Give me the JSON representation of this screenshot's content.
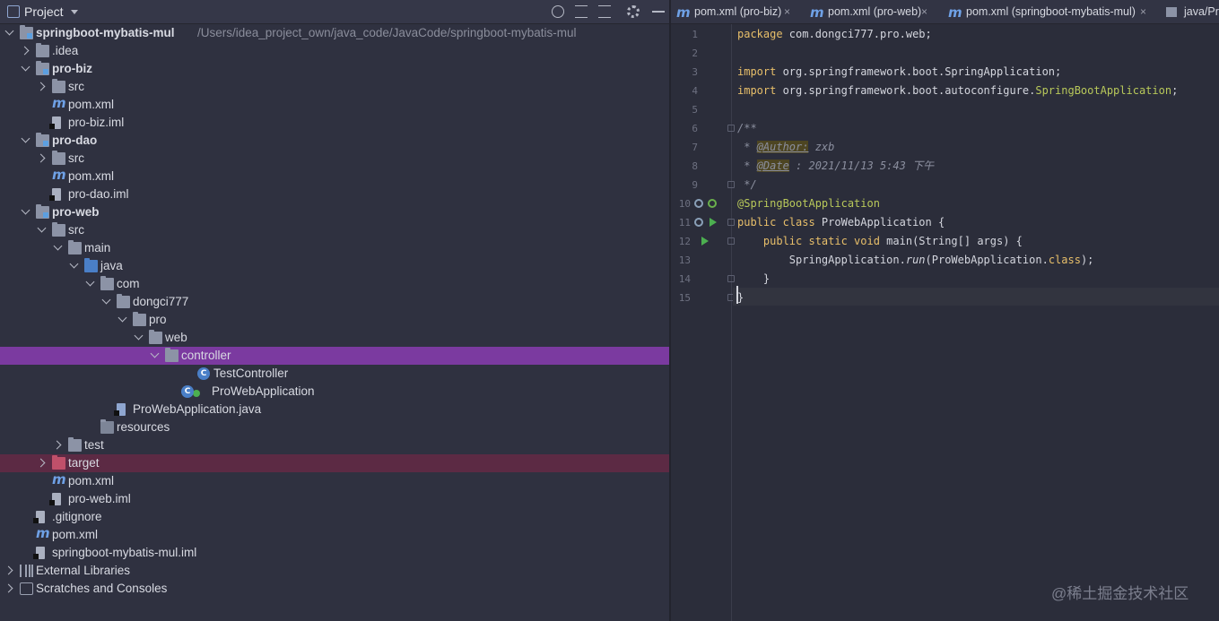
{
  "panel": {
    "title": "Project",
    "toolbar_icons": [
      "crosshair-icon",
      "expand-all-icon",
      "collapse-all-icon",
      "gear-icon",
      "hide-icon"
    ]
  },
  "tree": [
    {
      "label": "springboot-mybatis-mul",
      "path": "/Users/idea_project_own/java_code/JavaCode/springboot-mybatis-mul",
      "bold": true,
      "depth": 0,
      "arrow": "open",
      "icon": "module-folder-icon"
    },
    {
      "label": ".idea",
      "depth": 1,
      "arrow": "closed",
      "icon": "folder-icon"
    },
    {
      "label": "pro-biz",
      "bold": true,
      "depth": 1,
      "arrow": "open",
      "icon": "module-folder-icon"
    },
    {
      "label": "src",
      "depth": 2,
      "arrow": "closed",
      "icon": "folder-icon"
    },
    {
      "label": "pom.xml",
      "depth": 2,
      "arrow": "none",
      "icon": "maven-icon"
    },
    {
      "label": "pro-biz.iml",
      "depth": 2,
      "arrow": "none",
      "icon": "iml-file-icon"
    },
    {
      "label": "pro-dao",
      "bold": true,
      "depth": 1,
      "arrow": "open",
      "icon": "module-folder-icon"
    },
    {
      "label": "src",
      "depth": 2,
      "arrow": "closed",
      "icon": "folder-icon"
    },
    {
      "label": "pom.xml",
      "depth": 2,
      "arrow": "none",
      "icon": "maven-icon"
    },
    {
      "label": "pro-dao.iml",
      "depth": 2,
      "arrow": "none",
      "icon": "iml-file-icon"
    },
    {
      "label": "pro-web",
      "bold": true,
      "depth": 1,
      "arrow": "open",
      "icon": "module-folder-icon"
    },
    {
      "label": "src",
      "depth": 2,
      "arrow": "open",
      "icon": "folder-icon"
    },
    {
      "label": "main",
      "depth": 3,
      "arrow": "open",
      "icon": "folder-icon"
    },
    {
      "label": "java",
      "depth": 4,
      "arrow": "open",
      "icon": "source-folder-icon"
    },
    {
      "label": "com",
      "depth": 5,
      "arrow": "open",
      "icon": "package-icon"
    },
    {
      "label": "dongci777",
      "depth": 6,
      "arrow": "open",
      "icon": "package-icon"
    },
    {
      "label": "pro",
      "depth": 7,
      "arrow": "open",
      "icon": "package-icon"
    },
    {
      "label": "web",
      "depth": 8,
      "arrow": "open",
      "icon": "package-icon"
    },
    {
      "label": "controller",
      "depth": 9,
      "arrow": "open",
      "icon": "package-icon",
      "selected": "purple"
    },
    {
      "label": "TestController",
      "depth": 11,
      "arrow": "none",
      "icon": "class-icon"
    },
    {
      "label": "ProWebApplication",
      "depth": 10,
      "arrow": "none",
      "icon": "spring-class-icon"
    },
    {
      "label": "ProWebApplication.java",
      "depth": 6,
      "arrow": "none",
      "icon": "java-file-icon"
    },
    {
      "label": "resources",
      "depth": 5,
      "arrow": "none",
      "icon": "resources-folder-icon"
    },
    {
      "label": "test",
      "depth": 3,
      "arrow": "closed",
      "icon": "folder-icon"
    },
    {
      "label": "target",
      "depth": 2,
      "arrow": "closed",
      "icon": "excluded-folder-icon",
      "selected": "red"
    },
    {
      "label": "pom.xml",
      "depth": 2,
      "arrow": "none",
      "icon": "maven-icon"
    },
    {
      "label": "pro-web.iml",
      "depth": 2,
      "arrow": "none",
      "icon": "iml-file-icon"
    },
    {
      "label": ".gitignore",
      "depth": 1,
      "arrow": "none",
      "icon": "gitignore-icon"
    },
    {
      "label": "pom.xml",
      "depth": 1,
      "arrow": "none",
      "icon": "maven-icon"
    },
    {
      "label": "springboot-mybatis-mul.iml",
      "depth": 1,
      "arrow": "none",
      "icon": "iml-file-icon"
    },
    {
      "label": "External Libraries",
      "depth": 0,
      "arrow": "closed",
      "icon": "library-icon"
    },
    {
      "label": "Scratches and Consoles",
      "depth": 0,
      "arrow": "closed",
      "icon": "scratches-icon"
    }
  ],
  "tabs": [
    {
      "label": "pom.xml (pro-biz)",
      "close": "×"
    },
    {
      "label": "pom.xml (pro-web)",
      "close": "×"
    },
    {
      "label": "pom.xml (springboot-mybatis-mul)",
      "close": "×"
    },
    {
      "label": "java/Pr",
      "close": ""
    }
  ],
  "editor": {
    "line_numbers": [
      "1",
      "2",
      "3",
      "4",
      "5",
      "6",
      "7",
      "8",
      "9",
      "10",
      "11",
      "12",
      "13",
      "14",
      "15"
    ],
    "lines": [
      [
        [
          "kw",
          "package"
        ],
        [
          "plain",
          " com.dongci777.pro.web;"
        ]
      ],
      [],
      [
        [
          "kw",
          "import"
        ],
        [
          "plain",
          " org.springframework.boot.SpringApplication;"
        ]
      ],
      [
        [
          "kw",
          "import"
        ],
        [
          "plain",
          " org.springframework.boot.autoconfigure."
        ],
        [
          "anno",
          "SpringBootApplication"
        ],
        [
          "plain",
          ";"
        ]
      ],
      [],
      [
        [
          "cm",
          "/**"
        ]
      ],
      [
        [
          "cm",
          " * "
        ],
        [
          "tag",
          "@Author:"
        ],
        [
          "cm",
          " zxb"
        ]
      ],
      [
        [
          "cm",
          " * "
        ],
        [
          "tag",
          "@Date"
        ],
        [
          "cm",
          " : 2021/11/13 5:43 下午"
        ]
      ],
      [
        [
          "cm",
          " */"
        ]
      ],
      [
        [
          "anno",
          "@SpringBootApplication"
        ]
      ],
      [
        [
          "kw",
          "public class"
        ],
        [
          "plain",
          " ProWebApplication {"
        ]
      ],
      [
        [
          "plain",
          "    "
        ],
        [
          "kw",
          "public static void"
        ],
        [
          "plain",
          " main(String[] args) {"
        ]
      ],
      [
        [
          "plain",
          "        SpringApplication."
        ],
        [
          "fn",
          "run"
        ],
        [
          "plain",
          "(ProWebApplication."
        ],
        [
          "kw",
          "class"
        ],
        [
          "plain",
          ");"
        ]
      ],
      [
        [
          "plain",
          "    }"
        ]
      ],
      [
        [
          "plain",
          "}"
        ]
      ]
    ]
  },
  "watermark": "@稀土掘金技术社区",
  "colors": {
    "selection_purple": "#7b3aa0",
    "selection_red": "#5c2a44",
    "keyword": "#e8bf6a",
    "annotation": "#b8c85a",
    "maven_blue": "#6fa1e6"
  }
}
